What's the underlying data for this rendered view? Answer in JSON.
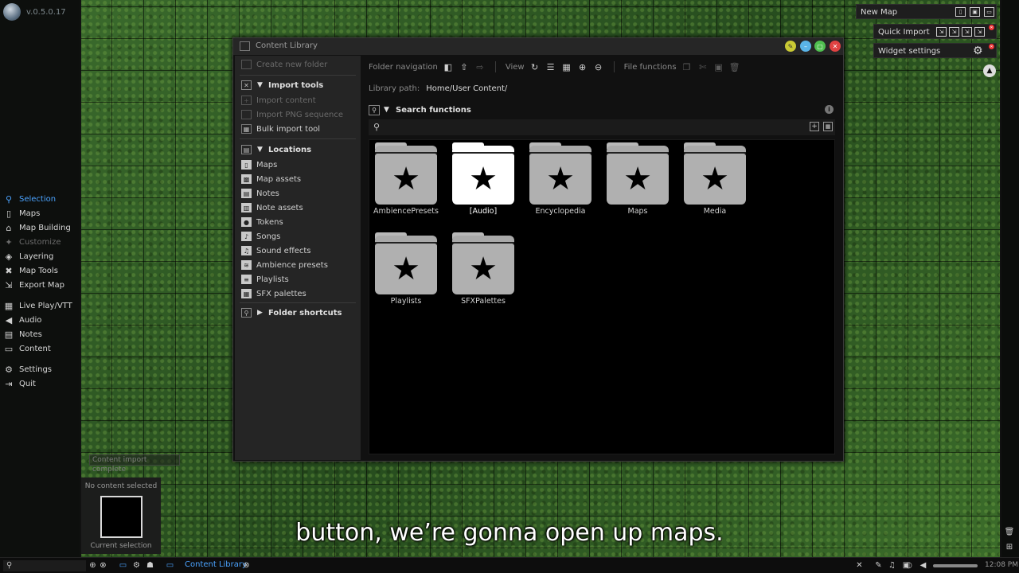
{
  "app": {
    "version": "v.0.5.0.17"
  },
  "sidebar": {
    "items": [
      {
        "label": "Selection",
        "icon": "selection-icon"
      },
      {
        "label": "Maps",
        "icon": "map-icon"
      },
      {
        "label": "Map Building",
        "icon": "building-icon"
      },
      {
        "label": "Customize",
        "icon": "wand-icon"
      },
      {
        "label": "Layering",
        "icon": "layers-icon"
      },
      {
        "label": "Map Tools",
        "icon": "tools-icon"
      },
      {
        "label": "Export Map",
        "icon": "export-icon"
      },
      {
        "label": "Live Play/VTT",
        "icon": "liveplay-icon"
      },
      {
        "label": "Audio",
        "icon": "speaker-icon"
      },
      {
        "label": "Notes",
        "icon": "notes-icon"
      },
      {
        "label": "Content",
        "icon": "folder-icon"
      },
      {
        "label": "Settings",
        "icon": "gear-icon"
      },
      {
        "label": "Quit",
        "icon": "quit-icon"
      }
    ]
  },
  "toast": "Content import complete",
  "selection_panel": {
    "title": "No content selected",
    "caption": "Current selection"
  },
  "window": {
    "title": "Content Library",
    "left": {
      "create_folder": "Create new folder",
      "import_tools": {
        "header": "Import tools",
        "items": [
          "Import content",
          "Import PNG sequence",
          "Bulk import tool"
        ]
      },
      "locations": {
        "header": "Locations",
        "items": [
          "Maps",
          "Map assets",
          "Notes",
          "Note assets",
          "Tokens",
          "Songs",
          "Sound effects",
          "Ambience presets",
          "Playlists",
          "SFX palettes"
        ]
      },
      "folder_shortcuts": "Folder shortcuts"
    },
    "toolbar": {
      "folder_nav": "Folder navigation",
      "view": "View",
      "file_functions": "File functions"
    },
    "library_path": {
      "label": "Library path:",
      "value": "Home/User Content/"
    },
    "search": {
      "header": "Search functions",
      "placeholder": ""
    },
    "folders": [
      {
        "name": "AmbiencePresets",
        "selected": false
      },
      {
        "name": "[Audio]",
        "selected": true
      },
      {
        "name": "Encyclopedia",
        "selected": false
      },
      {
        "name": "Maps",
        "selected": false
      },
      {
        "name": "Media",
        "selected": false
      },
      {
        "name": "Playlists",
        "selected": false
      },
      {
        "name": "SFXPalettes",
        "selected": false
      }
    ]
  },
  "widgets": {
    "new_map": "New Map",
    "quick_import": "Quick Import",
    "widget_settings": "Widget settings"
  },
  "subtitle": "button, we’re gonna open up maps.",
  "taskbar": {
    "task_label": "Content Library",
    "time": "12:08 PM"
  },
  "colors": {
    "accent": "#4ba3ff",
    "window_bg": "#111111",
    "panel_bg": "#252525"
  }
}
